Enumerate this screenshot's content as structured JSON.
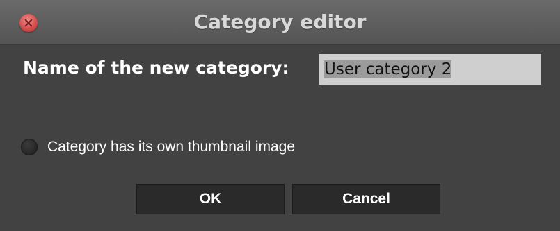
{
  "window": {
    "title": "Category editor"
  },
  "form": {
    "name_label": "Name of the new category:",
    "name_value": "User category 2",
    "thumbnail_label": "Category has its own thumbnail image",
    "thumbnail_checked": false
  },
  "buttons": {
    "ok_label": "OK",
    "cancel_label": "Cancel"
  },
  "colors": {
    "background": "#424242",
    "titlebar": "#5e5e5e",
    "input_background": "#cfcfcf",
    "button_background": "#2a2a2a",
    "close_button": "#d34a4a"
  }
}
